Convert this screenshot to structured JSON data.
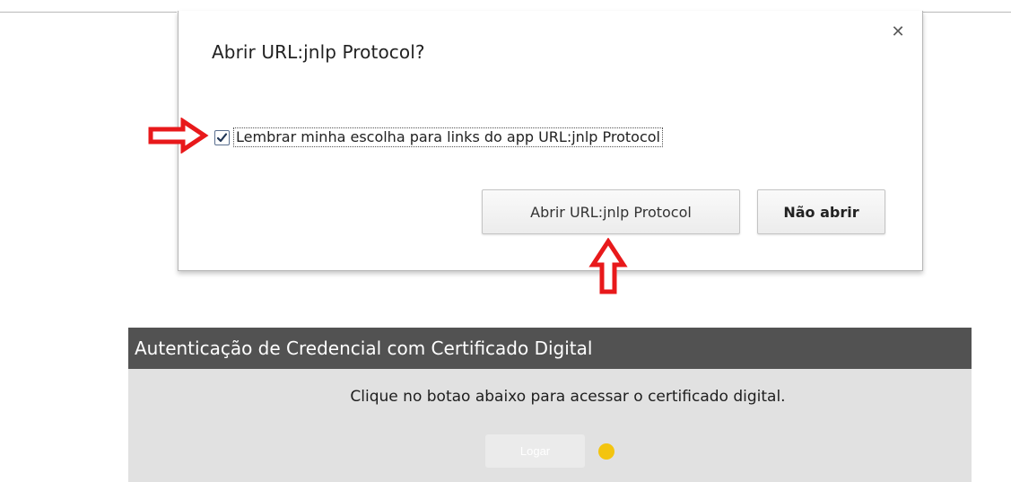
{
  "dialog": {
    "title": "Abrir URL:jnlp Protocol?",
    "close_icon": "close-icon",
    "remember_checked": true,
    "remember_label": "Lembrar minha escolha para links do app URL:jnlp Protocol",
    "open_button_label": "Abrir URL:jnlp Protocol",
    "dont_open_button_label": "Não abrir"
  },
  "annotations": {
    "arrow_color": "#e8191b"
  },
  "auth_panel": {
    "header": "Autenticação de Credencial com Certificado Digital",
    "instruction": "Clique no botao abaixo para acessar o certificado digital.",
    "login_button_label": "Logar",
    "status_color": "#f3c40f"
  }
}
